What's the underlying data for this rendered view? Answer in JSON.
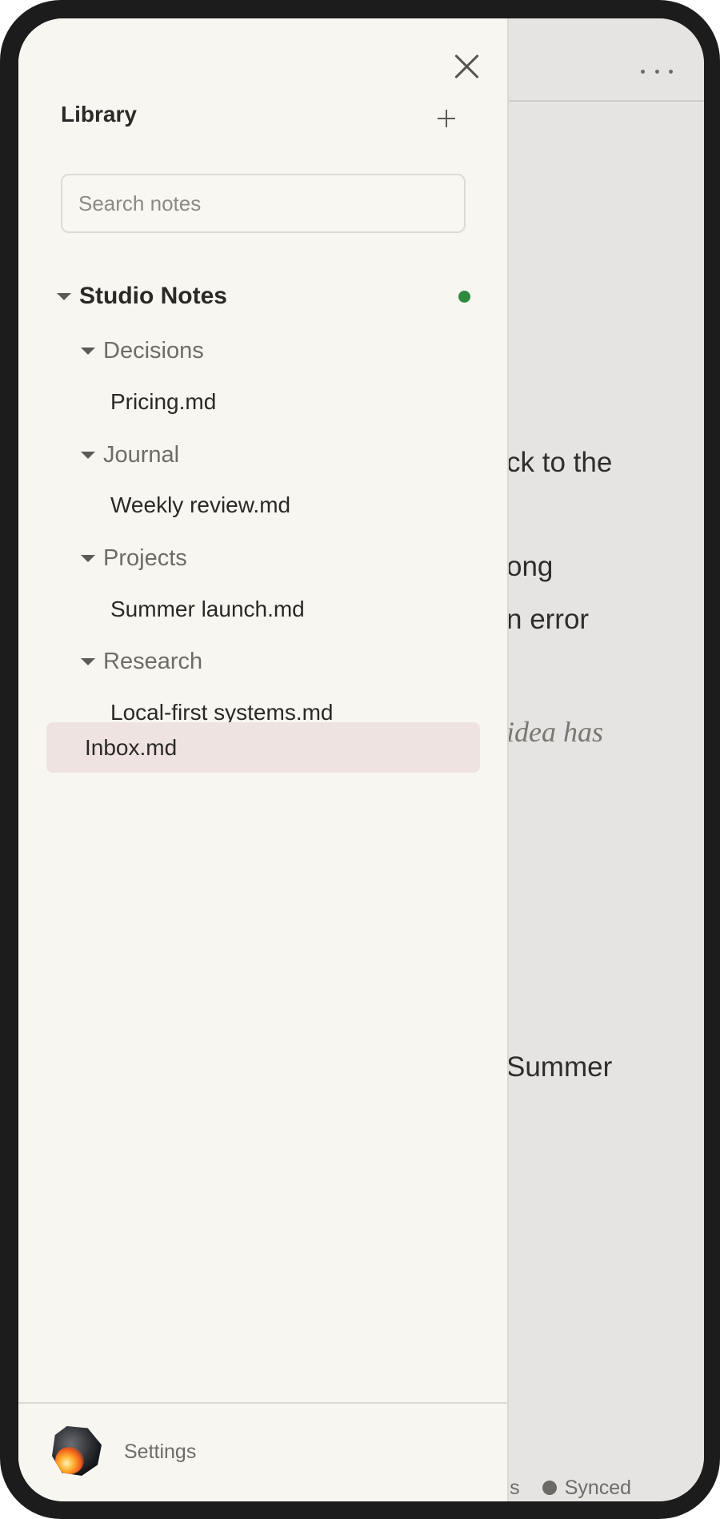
{
  "editor": {
    "lines": [
      "ck to the",
      "ong",
      "n error",
      "idea has",
      "Summer"
    ],
    "status": {
      "word_count_fragment": "words",
      "sync_status": "Synced"
    },
    "more_menu_icon": "more-horizontal-icon"
  },
  "sidebar": {
    "title": "Library",
    "close_icon": "close-icon",
    "add_icon": "plus-icon",
    "search": {
      "placeholder": "Search notes",
      "value": ""
    },
    "vault": {
      "name": "Studio Notes",
      "status_color": "#2e8b3e",
      "folders": [
        {
          "name": "Decisions",
          "files": [
            "Pricing.md"
          ]
        },
        {
          "name": "Journal",
          "files": [
            "Weekly review.md"
          ]
        },
        {
          "name": "Projects",
          "files": [
            "Summer launch.md"
          ]
        },
        {
          "name": "Research",
          "files": [
            "Local-first systems.md"
          ]
        }
      ],
      "root_files": [
        "Inbox.md"
      ],
      "selected_file": "Inbox.md"
    },
    "footer": {
      "settings_label": "Settings"
    }
  },
  "colors": {
    "selected_row": "#efe3e1",
    "drawer_background": "#f8f6f1",
    "sync_indicator": "#2e8b3e"
  }
}
